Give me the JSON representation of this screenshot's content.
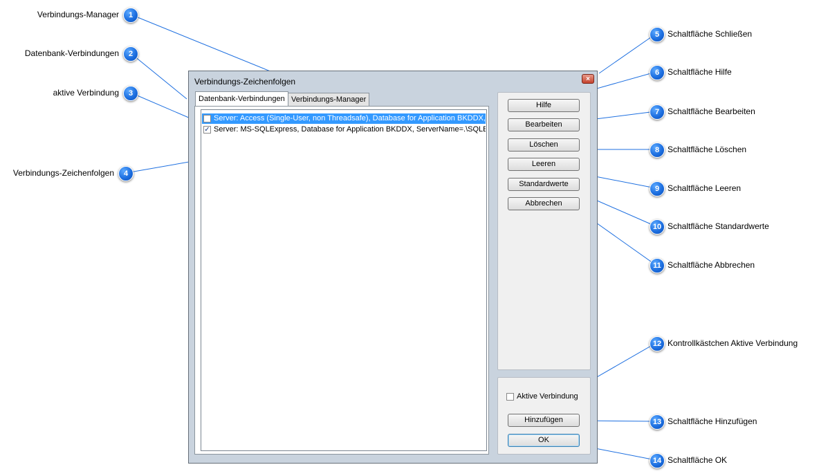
{
  "dialog": {
    "title": "Verbindungs-Zeichenfolgen",
    "close_glyph": "×",
    "tabs": [
      {
        "label": "Datenbank-Verbindungen",
        "active": true
      },
      {
        "label": "Verbindungs-Manager",
        "active": false
      }
    ],
    "connections": [
      {
        "text": "Server: Access (Single-User, non Threadsafe), Database for Application BKDDX,  ServerName=...",
        "checked": false,
        "selected": true
      },
      {
        "text": "Server: MS-SQLExpress, Database for Application BKDDX,  ServerName=.\\SQLExpress",
        "checked": true,
        "selected": false
      }
    ],
    "buttons": {
      "help": "Hilfe",
      "edit": "Bearbeiten",
      "delete": "Löschen",
      "clear": "Leeren",
      "defaults": "Standardwerte",
      "cancel": "Abbrechen",
      "add": "Hinzufügen",
      "ok": "OK"
    },
    "active_checkbox_label": "Aktive Verbindung",
    "check_glyph": "✓"
  },
  "callouts": [
    {
      "num": "1",
      "label": "Verbindungs-Manager"
    },
    {
      "num": "2",
      "label": "Datenbank-Verbindungen"
    },
    {
      "num": "3",
      "label": "aktive Verbindung"
    },
    {
      "num": "4",
      "label": "Verbindungs-Zeichenfolgen"
    },
    {
      "num": "5",
      "label": "Schaltfläche Schließen"
    },
    {
      "num": "6",
      "label": "Schaltfläche Hilfe"
    },
    {
      "num": "7",
      "label": "Schaltfläche Bearbeiten"
    },
    {
      "num": "8",
      "label": "Schaltfläche Löschen"
    },
    {
      "num": "9",
      "label": "Schaltfläche Leeren"
    },
    {
      "num": "10",
      "label": "Schaltfläche Standardwerte"
    },
    {
      "num": "11",
      "label": "Schaltfläche Abbrechen"
    },
    {
      "num": "12",
      "label": "Kontrollkästchen Aktive Verbindung"
    },
    {
      "num": "13",
      "label": "Schaltfläche Hinzufügen"
    },
    {
      "num": "14",
      "label": "Schaltfläche OK"
    }
  ],
  "colors": {
    "badge": "#1d6fe0",
    "selection": "#3399ff",
    "leader_line": "#1d6fe0"
  }
}
